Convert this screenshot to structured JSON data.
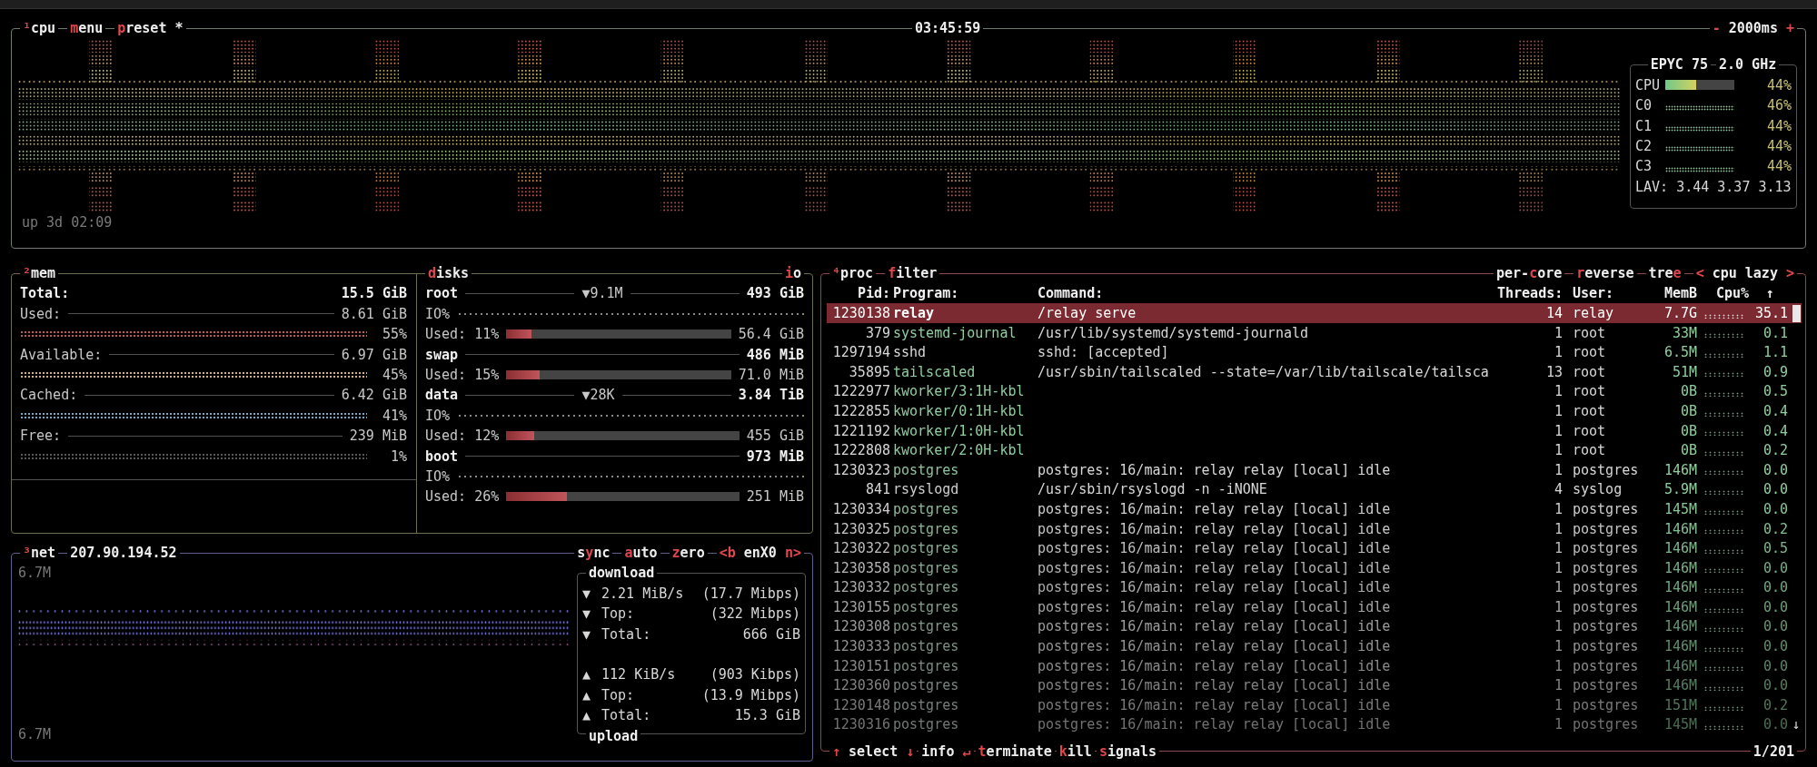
{
  "cpu": {
    "tabs": [
      {
        "parts": [
          {
            "t": "¹",
            "hot": true
          },
          {
            "t": "cpu",
            "hot": false
          }
        ]
      },
      {
        "parts": [
          {
            "t": "m",
            "hot": true
          },
          {
            "t": "enu",
            "hot": false
          }
        ]
      },
      {
        "parts": [
          {
            "t": "p",
            "hot": true
          },
          {
            "t": "reset *",
            "hot": false
          }
        ]
      }
    ],
    "clock": "03:45:59",
    "interval": {
      "parts": [
        {
          "t": "-",
          "hot": true
        },
        {
          "t": " 2000ms ",
          "hot": false
        },
        {
          "t": "+",
          "hot": true
        }
      ]
    },
    "uptime": "up 3d 02:09",
    "info": {
      "model": "EPYC 75",
      "clock": "2.0 GHz",
      "rows": [
        {
          "kind": "bar",
          "label": "CPU",
          "level": 0.44,
          "pct": "44%"
        },
        {
          "kind": "graph",
          "label": "C0",
          "pct": "46%"
        },
        {
          "kind": "graph",
          "label": "C1",
          "pct": "44%"
        },
        {
          "kind": "graph",
          "label": "C2",
          "pct": "44%"
        },
        {
          "kind": "graph",
          "label": "C3",
          "pct": "44%"
        }
      ],
      "load": "LAV: 3.44 3.37 3.13"
    }
  },
  "mem": {
    "tabs": [
      {
        "parts": [
          {
            "t": "²",
            "hot": true
          },
          {
            "t": "mem",
            "hot": false
          }
        ]
      }
    ],
    "rows": [
      {
        "kind": "total",
        "label": "Total:",
        "value": "15.5 GiB"
      },
      {
        "kind": "stat",
        "label": "Used:",
        "value": "8.61 GiB",
        "pct": "55%",
        "color": "#c2585a"
      },
      {
        "kind": "stat",
        "label": "Available:",
        "value": "6.97 GiB",
        "pct": "45%",
        "color": "#d4b46a"
      },
      {
        "kind": "stat",
        "label": "Cached:",
        "value": "6.42 GiB",
        "pct": "41%",
        "color": "#6fa8c8"
      },
      {
        "kind": "stat",
        "label": "Free:",
        "value": "239 MiB",
        "pct": "1%",
        "color": "#5a5a5a"
      }
    ]
  },
  "disks": {
    "tabs_left": [
      {
        "parts": [
          {
            "t": "d",
            "hot": true
          },
          {
            "t": "isks",
            "hot": false
          }
        ]
      }
    ],
    "tabs_right": [
      {
        "parts": [
          {
            "t": "i",
            "hot": true
          },
          {
            "t": "o",
            "hot": false
          }
        ]
      }
    ],
    "items": [
      {
        "name": "root",
        "io": "▼9.1M",
        "size": "493 GiB",
        "io_label": "IO%",
        "used_label": "Used: 11%",
        "level": 0.11,
        "used": "56.4 GiB"
      },
      {
        "name": "swap",
        "size": "486 MiB",
        "used_label": "Used: 15%",
        "level": 0.15,
        "used": "71.0 MiB"
      },
      {
        "name": "data",
        "io": "▼28K",
        "size": "3.84 TiB",
        "io_label": "IO%",
        "used_label": "Used: 12%",
        "level": 0.12,
        "used": "455 GiB"
      },
      {
        "name": "boot",
        "size": "973 MiB",
        "io_label": "IO%",
        "used_label": "Used: 26%",
        "level": 0.26,
        "used": "251 MiB"
      }
    ]
  },
  "net": {
    "tabs": [
      {
        "parts": [
          {
            "t": "³",
            "hot": true
          },
          {
            "t": "net",
            "hot": false
          }
        ]
      },
      {
        "parts": [
          {
            "t": "207.90.194.52",
            "hot": false
          }
        ]
      }
    ],
    "controls": [
      {
        "parts": [
          {
            "t": "s",
            "hot": false
          },
          {
            "t": "y",
            "hot": true
          },
          {
            "t": "nc",
            "hot": false
          }
        ]
      },
      {
        "parts": [
          {
            "t": "a",
            "hot": true
          },
          {
            "t": "uto",
            "hot": false
          }
        ]
      },
      {
        "parts": [
          {
            "t": "z",
            "hot": true
          },
          {
            "t": "ero",
            "hot": false
          }
        ]
      },
      {
        "parts": [
          {
            "t": "<b",
            "hot": true
          },
          {
            "t": " enX0 ",
            "hot": false
          },
          {
            "t": "n>",
            "hot": true
          }
        ]
      }
    ],
    "scale_top": "6.7M",
    "scale_bottom": "6.7M",
    "download": {
      "title": "download",
      "rows": [
        {
          "arrow": "▼",
          "label": "2.21 MiB/s",
          "value": "(17.7 Mibps)"
        },
        {
          "arrow": "▼",
          "label": "Top:",
          "value": "(322 Mibps)"
        },
        {
          "arrow": "▼",
          "label": "Total:",
          "value": "666 GiB"
        }
      ]
    },
    "upload": {
      "title": "upload",
      "rows": [
        {
          "arrow": "▲",
          "label": "112 KiB/s",
          "value": "(903 Kibps)"
        },
        {
          "arrow": "▲",
          "label": "Top:",
          "value": "(13.9 Mibps)"
        },
        {
          "arrow": "▲",
          "label": "Total:",
          "value": "15.3 GiB"
        }
      ]
    }
  },
  "proc": {
    "tabs_left": [
      {
        "parts": [
          {
            "t": "⁴",
            "hot": true
          },
          {
            "t": "proc",
            "hot": false
          }
        ]
      },
      {
        "parts": [
          {
            "t": "f",
            "hot": true
          },
          {
            "t": "ilter",
            "hot": false
          }
        ]
      }
    ],
    "tabs_right": [
      {
        "parts": [
          {
            "t": "per-",
            "hot": false
          },
          {
            "t": "c",
            "hot": true
          },
          {
            "t": "ore",
            "hot": false
          }
        ]
      },
      {
        "parts": [
          {
            "t": "r",
            "hot": true
          },
          {
            "t": "everse",
            "hot": false
          }
        ]
      },
      {
        "parts": [
          {
            "t": "tre",
            "hot": false
          },
          {
            "t": "e",
            "hot": true
          }
        ]
      },
      {
        "parts": [
          {
            "t": "<",
            "hot": true
          },
          {
            "t": " cpu lazy ",
            "hot": false
          },
          {
            "t": ">",
            "hot": true
          }
        ]
      }
    ],
    "columns": [
      "Pid:",
      "Program:",
      "Command:",
      "Threads:",
      "User:",
      "MemB",
      "Cpu%"
    ],
    "scroll_up": "↑",
    "scroll_down": "↓",
    "rows": [
      {
        "pid": "1230138",
        "program": "relay",
        "command": "/relay serve",
        "threads": "14",
        "user": "relay",
        "mem": "7.7G",
        "cpu": "35.1",
        "selected": true,
        "color": "#ffffff"
      },
      {
        "pid": "379",
        "program": "systemd-journal",
        "command": "/usr/lib/systemd/systemd-journald",
        "threads": "1",
        "user": "root",
        "mem": "33M",
        "cpu": "0.1",
        "selected": false,
        "color": "#8fcf9f"
      },
      {
        "pid": "1297194",
        "program": "sshd",
        "command": "sshd: [accepted]",
        "threads": "1",
        "user": "root",
        "mem": "6.5M",
        "cpu": "1.1",
        "selected": false,
        "color": "#d9d9d9"
      },
      {
        "pid": "35895",
        "program": "tailscaled",
        "command": "/usr/sbin/tailscaled --state=/var/lib/tailscale/tailsca",
        "threads": "13",
        "user": "root",
        "mem": "51M",
        "cpu": "0.9",
        "selected": false,
        "color": "#8fcf9f"
      },
      {
        "pid": "1222977",
        "program": "kworker/3:1H-kbl",
        "threads": "1",
        "user": "root",
        "mem": "0B",
        "cpu": "0.5",
        "selected": false,
        "color": "#8fcf9f"
      },
      {
        "pid": "1222855",
        "program": "kworker/0:1H-kbl",
        "threads": "1",
        "user": "root",
        "mem": "0B",
        "cpu": "0.4",
        "selected": false,
        "color": "#8fcf9f"
      },
      {
        "pid": "1221192",
        "program": "kworker/1:0H-kbl",
        "threads": "1",
        "user": "root",
        "mem": "0B",
        "cpu": "0.4",
        "selected": false,
        "color": "#8fcf9f"
      },
      {
        "pid": "1222808",
        "program": "kworker/2:0H-kbl",
        "threads": "1",
        "user": "root",
        "mem": "0B",
        "cpu": "0.2",
        "selected": false,
        "color": "#8fcf9f"
      },
      {
        "pid": "1230323",
        "program": "postgres",
        "command": "postgres: 16/main: relay relay [local] idle",
        "threads": "1",
        "user": "postgres",
        "mem": "146M",
        "cpu": "0.0",
        "selected": false,
        "color": "#8fc49c"
      },
      {
        "pid": "841",
        "program": "rsyslogd",
        "command": "/usr/sbin/rsyslogd -n -iNONE",
        "threads": "4",
        "user": "syslog",
        "mem": "5.9M",
        "cpu": "0.0",
        "selected": false,
        "color": "#cfcfcf"
      },
      {
        "pid": "1230334",
        "program": "postgres",
        "command": "postgres: 16/main: relay relay [local] idle",
        "threads": "1",
        "user": "postgres",
        "mem": "145M",
        "cpu": "0.0",
        "selected": false,
        "color": "#8dbc99"
      },
      {
        "pid": "1230325",
        "program": "postgres",
        "command": "postgres: 16/main: relay relay [local] idle",
        "threads": "1",
        "user": "postgres",
        "mem": "146M",
        "cpu": "0.2",
        "selected": false,
        "color": "#8bb696"
      },
      {
        "pid": "1230322",
        "program": "postgres",
        "command": "postgres: 16/main: relay relay [local] idle",
        "threads": "1",
        "user": "postgres",
        "mem": "146M",
        "cpu": "0.5",
        "selected": false,
        "color": "#89b094"
      },
      {
        "pid": "1230358",
        "program": "postgres",
        "command": "postgres: 16/main: relay relay [local] idle",
        "threads": "1",
        "user": "postgres",
        "mem": "146M",
        "cpu": "0.0",
        "selected": false,
        "color": "#87aa91"
      },
      {
        "pid": "1230332",
        "program": "postgres",
        "command": "postgres: 16/main: relay relay [local] idle",
        "threads": "1",
        "user": "postgres",
        "mem": "146M",
        "cpu": "0.0",
        "selected": false,
        "color": "#85a48e"
      },
      {
        "pid": "1230155",
        "program": "postgres",
        "command": "postgres: 16/main: relay relay [local] idle",
        "threads": "1",
        "user": "postgres",
        "mem": "146M",
        "cpu": "0.0",
        "selected": false,
        "color": "#839e8b"
      },
      {
        "pid": "1230308",
        "program": "postgres",
        "command": "postgres: 16/main: relay relay [local] idle",
        "threads": "1",
        "user": "postgres",
        "mem": "146M",
        "cpu": "0.0",
        "selected": false,
        "color": "#809888"
      },
      {
        "pid": "1230333",
        "program": "postgres",
        "command": "postgres: 16/main: relay relay [local] idle",
        "threads": "1",
        "user": "postgres",
        "mem": "146M",
        "cpu": "0.0",
        "selected": false,
        "color": "#7e9286"
      },
      {
        "pid": "1230151",
        "program": "postgres",
        "command": "postgres: 16/main: relay relay [local] idle",
        "threads": "1",
        "user": "postgres",
        "mem": "146M",
        "cpu": "0.0",
        "selected": false,
        "color": "#7b8c83"
      },
      {
        "pid": "1230360",
        "program": "postgres",
        "command": "postgres: 16/main: relay relay [local] idle",
        "threads": "1",
        "user": "postgres",
        "mem": "146M",
        "cpu": "0.0",
        "selected": false,
        "color": "#788680"
      },
      {
        "pid": "1230148",
        "program": "postgres",
        "command": "postgres: 16/main: relay relay [local] idle",
        "threads": "1",
        "user": "postgres",
        "mem": "151M",
        "cpu": "0.2",
        "selected": false,
        "color": "#75807c"
      },
      {
        "pid": "1230316",
        "program": "postgres",
        "command": "postgres: 16/main: relay relay [local] idle",
        "threads": "1",
        "user": "postgres",
        "mem": "145M",
        "cpu": "0.0",
        "selected": false,
        "color": "#727b78"
      }
    ],
    "footer": [
      {
        "parts": [
          {
            "t": "↑",
            "hot": true
          },
          {
            "t": " select ",
            "hot": false
          },
          {
            "t": "↓",
            "hot": true
          }
        ]
      },
      {
        "parts": [
          {
            "t": "info ",
            "hot": false
          },
          {
            "t": "↵",
            "hot": true
          }
        ]
      },
      {
        "parts": [
          {
            "t": "t",
            "hot": true
          },
          {
            "t": "erminate",
            "hot": false
          }
        ]
      },
      {
        "parts": [
          {
            "t": "k",
            "hot": true
          },
          {
            "t": "ill",
            "hot": false
          }
        ]
      },
      {
        "parts": [
          {
            "t": "s",
            "hot": true
          },
          {
            "t": "ignals",
            "hot": false
          }
        ]
      }
    ],
    "count": "1/201"
  }
}
